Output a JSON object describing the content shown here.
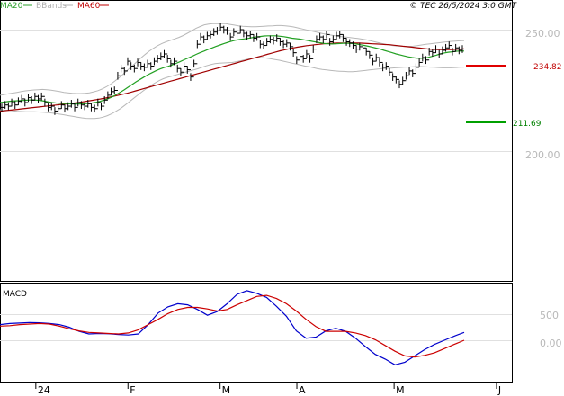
{
  "header": {
    "legend": [
      {
        "label": "MA20",
        "color": "#2ca02c"
      },
      {
        "label": "BBands",
        "color": "#b0b0b0"
      },
      {
        "label": "MA60",
        "color": "#c00000"
      }
    ],
    "source": "© TEC 26/5/2024 3:0 GMT"
  },
  "chart_data": [
    {
      "type": "candlestick",
      "title": "",
      "ylim": [
        195,
        265
      ],
      "grid": true,
      "yticks": [
        {
          "value": 250,
          "label": "250.00"
        },
        {
          "value": 200,
          "label": "200.00"
        }
      ],
      "xticks": [
        {
          "x": 0.07,
          "label": "24"
        },
        {
          "x": 0.25,
          "label": "F"
        },
        {
          "x": 0.43,
          "label": "M"
        },
        {
          "x": 0.58,
          "label": "A"
        },
        {
          "x": 0.77,
          "label": "M"
        },
        {
          "x": 0.97,
          "label": "J"
        }
      ],
      "levels": [
        {
          "name": "resistance",
          "value": 234.82,
          "label": "234.82",
          "color": "#e00000"
        },
        {
          "name": "support",
          "value": 211.69,
          "label": "211.69",
          "color": "#00a000"
        }
      ],
      "series": {
        "price": [
          218,
          219,
          218.5,
          220,
          219,
          220.5,
          221.5,
          220,
          222,
          221,
          222.5,
          221.5,
          222.5,
          220,
          218,
          218.5,
          216.5,
          217.5,
          219,
          217.5,
          218.5,
          219.5,
          218,
          220,
          219,
          218.5,
          219.5,
          218,
          217.5,
          220,
          218.5,
          221,
          223,
          224.5,
          225,
          231,
          234,
          233,
          237,
          235,
          234,
          236.5,
          235,
          234.5,
          236,
          235,
          237,
          238,
          239,
          240,
          238,
          236,
          237,
          234,
          232.5,
          235,
          233.5,
          230.5,
          236,
          244,
          247,
          246,
          247.5,
          248,
          249,
          249.5,
          251,
          250,
          249.5,
          247,
          249,
          248.5,
          250,
          248.5,
          247.5,
          248,
          246.5,
          247,
          244,
          243.5,
          245,
          246,
          245.5,
          246.5,
          245,
          244,
          244.5,
          243,
          240.5,
          237.5,
          239,
          238,
          240,
          238,
          242,
          246,
          247,
          246,
          248,
          245,
          246,
          247.5,
          248,
          246.5,
          245,
          244.5,
          243.5,
          242,
          243,
          242.5,
          241,
          239.5,
          237,
          238.5,
          236.5,
          234.5,
          235,
          232.5,
          230.5,
          229.5,
          227.5,
          229,
          231,
          233,
          232,
          234.5,
          236.5,
          238.5,
          237.5,
          241,
          240.5,
          242,
          240,
          241.5,
          242.5,
          243.5,
          241,
          242.5,
          241.5,
          242
        ],
        "ma20": [
          220,
          220.2,
          220.4,
          220.6,
          220.7,
          220.8,
          220.9,
          221,
          221.1,
          221,
          220.9,
          220.6,
          220.3,
          220,
          219.8,
          219.7,
          219.6,
          219.5,
          219.4,
          219.4,
          219.4,
          219.5,
          219.6,
          219.8,
          220.1,
          220.5,
          221,
          221.6,
          222.3,
          223.2,
          224.2,
          225.2,
          226.3,
          227.4,
          228.5,
          229.5,
          230.5,
          231.5,
          232.3,
          233.1,
          233.8,
          234.4,
          234.9,
          235.5,
          236.1,
          236.8,
          237.6,
          238.3,
          239,
          239.8,
          240.5,
          241.2,
          241.9,
          242.5,
          243.1,
          243.7,
          244.3,
          244.8,
          245.3,
          245.7,
          246,
          246.2,
          246.4,
          246.7,
          247,
          247.2,
          247.4,
          247.5,
          247.5,
          247.5,
          247.3,
          247.1,
          246.8,
          246.5,
          246.3,
          246.1,
          245.8,
          245.5,
          245.2,
          244.9,
          244.6,
          244.3,
          244.2,
          244.1,
          244.2,
          244.3,
          244.4,
          244.4,
          244.3,
          244.1,
          243.8,
          243.5,
          243.2,
          242.8,
          242.4,
          242,
          241.5,
          241,
          240.5,
          240,
          239.6,
          239.2,
          238.8,
          238.5,
          238.3,
          238.2,
          238.3,
          238.6,
          239,
          239.5,
          240,
          240.4,
          240.7,
          240.9,
          241.1,
          241.2,
          241.2
        ],
        "ma60": [
          216.4,
          216.6,
          216.8,
          217,
          217.2,
          217.4,
          217.6,
          217.8,
          218,
          218.2,
          218.4,
          218.6,
          218.8,
          219,
          219.2,
          219.4,
          219.6,
          219.8,
          220,
          220.3,
          220.6,
          220.9,
          221.2,
          221.5,
          221.8,
          222.2,
          222.6,
          223,
          223.4,
          223.8,
          224.3,
          224.8,
          225.3,
          225.8,
          226.3,
          226.8,
          227.3,
          227.8,
          228.3,
          228.8,
          229.3,
          229.8,
          230.3,
          230.8,
          231.3,
          231.8,
          232.3,
          232.8,
          233.3,
          233.8,
          234.3,
          234.8,
          235.3,
          235.8,
          236.3,
          236.8,
          237.3,
          237.8,
          238.3,
          238.8,
          239.3,
          239.8,
          240.3,
          240.8,
          241.3,
          241.7,
          242.1,
          242.5,
          242.8,
          243.1,
          243.4,
          243.6,
          243.8,
          244,
          244.2,
          244.3,
          244.4,
          244.5,
          244.5,
          244.5,
          244.5,
          244.5,
          244.5,
          244.4,
          244.3,
          244.2,
          244.1,
          244,
          243.9,
          243.8,
          243.6,
          243.4,
          243.2,
          243,
          242.8,
          242.6,
          242.4,
          242.2,
          242,
          241.9,
          241.8,
          241.8,
          241.8,
          241.8,
          241.9,
          242,
          242.1
        ],
        "bb_upper": [
          223,
          223.3,
          223.6,
          223.9,
          224.2,
          224.5,
          224.8,
          225,
          225.2,
          225.3,
          225.4,
          225.3,
          225.1,
          224.8,
          224.5,
          224.2,
          224,
          223.8,
          223.7,
          223.7,
          223.8,
          224,
          224.4,
          224.9,
          225.6,
          226.5,
          227.6,
          228.9,
          230.3,
          231.8,
          233.4,
          235,
          236.6,
          238.2,
          239.7,
          241.1,
          242.3,
          243.4,
          244.3,
          245,
          245.6,
          246.2,
          246.8,
          247.6,
          248.5,
          249.5,
          250.5,
          251.3,
          252,
          252.3,
          252.5,
          252.5,
          252.5,
          252.5,
          252.2,
          251.9,
          251.6,
          251.4,
          251.3,
          251.2,
          251.2,
          251.3,
          251.4,
          251.5,
          251.6,
          251.7,
          251.7,
          251.6,
          251.4,
          251.1,
          250.7,
          250.3,
          249.9,
          249.5,
          249.1,
          248.7,
          248.3,
          248,
          247.7,
          247.4,
          247.2,
          247,
          246.8,
          246.6,
          246.4,
          246.1,
          245.8,
          245.4,
          245,
          244.6,
          244.2,
          243.8,
          243.5,
          243.3,
          243.2,
          243.1,
          243.1,
          243.2,
          243.4,
          243.7,
          244,
          244.2,
          244.4,
          244.6,
          244.8,
          245,
          245.2,
          245.3,
          245.4,
          245.5
        ],
        "bb_lower": [
          217,
          216.9,
          216.8,
          216.6,
          216.4,
          216.3,
          216.2,
          216.2,
          216.2,
          216.1,
          216,
          215.9,
          215.7,
          215.5,
          215.2,
          214.9,
          214.6,
          214.3,
          214,
          213.7,
          213.5,
          213.4,
          213.4,
          213.6,
          214,
          214.6,
          215.4,
          216.4,
          217.5,
          218.8,
          220.2,
          221.6,
          223,
          224.4,
          225.7,
          226.9,
          228,
          229,
          229.8,
          230.4,
          230.9,
          231.4,
          231.9,
          232.4,
          232.9,
          233.4,
          233.9,
          234.5,
          235.1,
          235.6,
          236,
          236.2,
          236.3,
          236.4,
          236.5,
          236.8,
          237.2,
          237.6,
          238,
          238.3,
          238.5,
          238.5,
          238.3,
          238,
          237.7,
          237.4,
          237,
          236.6,
          236.2,
          235.8,
          235.4,
          235,
          234.7,
          234.3,
          233.9,
          233.6,
          233.4,
          233.2,
          233,
          232.9,
          232.8,
          232.7,
          232.7,
          232.8,
          233,
          233.2,
          233.4,
          233.6,
          233.8,
          234,
          234.1,
          234.2,
          234.3,
          234.4,
          234.5,
          234.6,
          234.7,
          234.8,
          234.8,
          234.7,
          234.6,
          234.5,
          234.4,
          234.3,
          234.3,
          234.3,
          234.4,
          234.5,
          234.6
        ]
      }
    },
    {
      "type": "line",
      "title": "MACD",
      "ylim": [
        -800,
        1500
      ],
      "yticks": [
        {
          "value": 500,
          "label": "500"
        },
        {
          "value": 0,
          "label": "0.00"
        }
      ],
      "series": [
        {
          "name": "MACD",
          "color": "#0000cc",
          "values": [
            300,
            320,
            330,
            340,
            335,
            320,
            300,
            250,
            170,
            120,
            130,
            125,
            110,
            100,
            120,
            300,
            520,
            640,
            700,
            680,
            590,
            480,
            550,
            700,
            880,
            950,
            900,
            820,
            650,
            460,
            180,
            40,
            60,
            180,
            230,
            170,
            40,
            -120,
            -270,
            -360,
            -470,
            -420,
            -300,
            -180,
            -80,
            0,
            80,
            150
          ]
        },
        {
          "name": "Signal",
          "color": "#cc0000",
          "values": [
            270,
            280,
            300,
            310,
            320,
            310,
            270,
            220,
            180,
            150,
            140,
            130,
            120,
            140,
            200,
            300,
            400,
            510,
            590,
            630,
            630,
            600,
            560,
            590,
            680,
            760,
            840,
            860,
            800,
            700,
            560,
            400,
            260,
            170,
            170,
            170,
            140,
            90,
            10,
            -100,
            -210,
            -300,
            -320,
            -290,
            -240,
            -160,
            -80,
            0
          ]
        }
      ]
    }
  ]
}
